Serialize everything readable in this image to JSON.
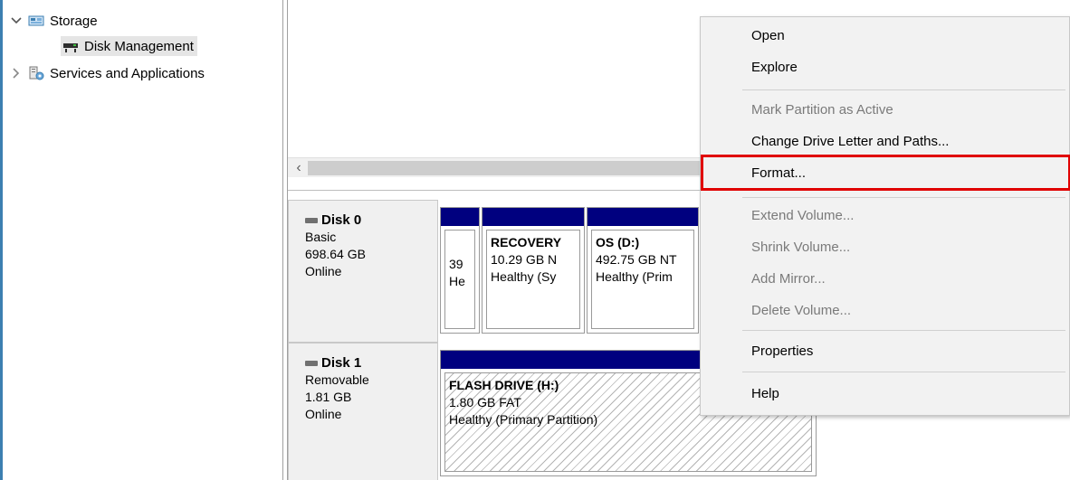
{
  "tree": {
    "storage_label": "Storage",
    "disk_management_label": "Disk Management",
    "services_label": "Services and Applications"
  },
  "disks": [
    {
      "name": "Disk 0",
      "type": "Basic",
      "size": "698.64 GB",
      "status": "Online",
      "partitions": [
        {
          "title": "",
          "line1": "39",
          "line2": "He"
        },
        {
          "title": "RECOVERY",
          "line1": "10.29 GB N",
          "line2": "Healthy (Sy"
        },
        {
          "title": "OS  (D:)",
          "line1": "492.75 GB NT",
          "line2": "Healthy (Prim"
        }
      ]
    },
    {
      "name": "Disk 1",
      "type": "Removable",
      "size": "1.81 GB",
      "status": "Online",
      "partitions": [
        {
          "title": "FLASH DRIVE  (H:)",
          "line1": "1.80 GB FAT",
          "line2": "Healthy (Primary Partition)"
        }
      ]
    }
  ],
  "menu": {
    "items": [
      {
        "label": "Open",
        "enabled": true
      },
      {
        "label": "Explore",
        "enabled": true
      },
      {
        "label": "Mark Partition as Active",
        "enabled": false
      },
      {
        "label": "Change Drive Letter and Paths...",
        "enabled": true
      },
      {
        "label": "Format...",
        "enabled": true,
        "highlighted": true
      },
      {
        "label": "Extend Volume...",
        "enabled": false
      },
      {
        "label": "Shrink Volume...",
        "enabled": false
      },
      {
        "label": "Add Mirror...",
        "enabled": false
      },
      {
        "label": "Delete Volume...",
        "enabled": false
      },
      {
        "label": "Properties",
        "enabled": true
      },
      {
        "label": "Help",
        "enabled": true
      }
    ]
  },
  "colors": {
    "partition_bar": "#00007f",
    "highlight_border": "#e00000",
    "menu_bg": "#f2f2f2"
  }
}
